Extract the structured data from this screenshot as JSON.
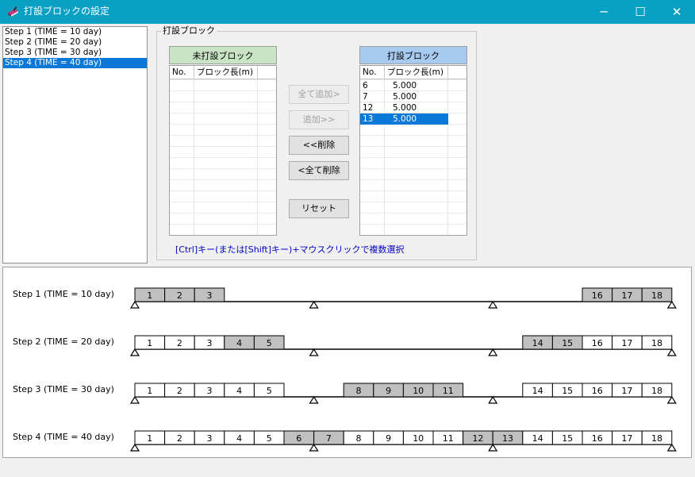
{
  "window": {
    "title": "打設ブロックの設定",
    "icon": "pencil-book-icon",
    "controls": {
      "minimize": "─",
      "maximize": "☐",
      "close": "✕"
    }
  },
  "steps": {
    "items": [
      {
        "label": "Step 1  (TIME = 10 day)",
        "selected": false
      },
      {
        "label": "Step 2  (TIME = 20 day)",
        "selected": false
      },
      {
        "label": "Step 3  (TIME = 30 day)",
        "selected": false
      },
      {
        "label": "Step 4  (TIME = 40 day)",
        "selected": true
      }
    ]
  },
  "group": {
    "label": "打設ブロック"
  },
  "unplaced": {
    "caption": "未打設ブロック",
    "caption_color": "#c9e4c4",
    "columns": [
      "No.",
      "ブロック長(m)"
    ],
    "rows": []
  },
  "placed": {
    "caption": "打設ブロック",
    "caption_color": "#a8caf0",
    "columns": [
      "No.",
      "ブロック長(m)"
    ],
    "rows": [
      {
        "no": "6",
        "length": "5.000",
        "selected": false
      },
      {
        "no": "7",
        "length": "5.000",
        "selected": false
      },
      {
        "no": "12",
        "length": "5.000",
        "selected": false
      },
      {
        "no": "13",
        "length": "5.000",
        "selected": true
      }
    ]
  },
  "buttons": {
    "add_all": {
      "label": "全て追加>",
      "enabled": false
    },
    "add": {
      "label": "追加>>",
      "enabled": false
    },
    "remove": {
      "label": "<<削除",
      "enabled": true
    },
    "remove_all": {
      "label": "<全て削除",
      "enabled": true
    },
    "reset": {
      "label": "リセット",
      "enabled": true
    }
  },
  "hint": "[Ctrl]キー(または[Shift]キー)+マウスクリックで複数選択",
  "diagram": {
    "block_count": 18,
    "shade_color": "#c0c0c0",
    "steps": [
      {
        "label": "Step 1  (TIME = 10 day)",
        "visible": [
          1,
          2,
          3,
          16,
          17,
          18
        ],
        "shaded": [
          1,
          2,
          3,
          16,
          17,
          18
        ]
      },
      {
        "label": "Step 2  (TIME = 20 day)",
        "visible": [
          1,
          2,
          3,
          4,
          5,
          14,
          15,
          16,
          17,
          18
        ],
        "shaded": [
          4,
          5,
          14,
          15
        ]
      },
      {
        "label": "Step 3  (TIME = 30 day)",
        "visible": [
          1,
          2,
          3,
          4,
          5,
          8,
          9,
          10,
          11,
          14,
          15,
          16,
          17,
          18
        ],
        "shaded": [
          8,
          9,
          10,
          11
        ]
      },
      {
        "label": "Step 4  (TIME = 40 day)",
        "visible": [
          1,
          2,
          3,
          4,
          5,
          6,
          7,
          8,
          9,
          10,
          11,
          12,
          13,
          14,
          15,
          16,
          17,
          18
        ],
        "shaded": [
          6,
          7,
          12,
          13
        ]
      }
    ],
    "supports_after_block": [
      0,
      6,
      12,
      18
    ]
  }
}
